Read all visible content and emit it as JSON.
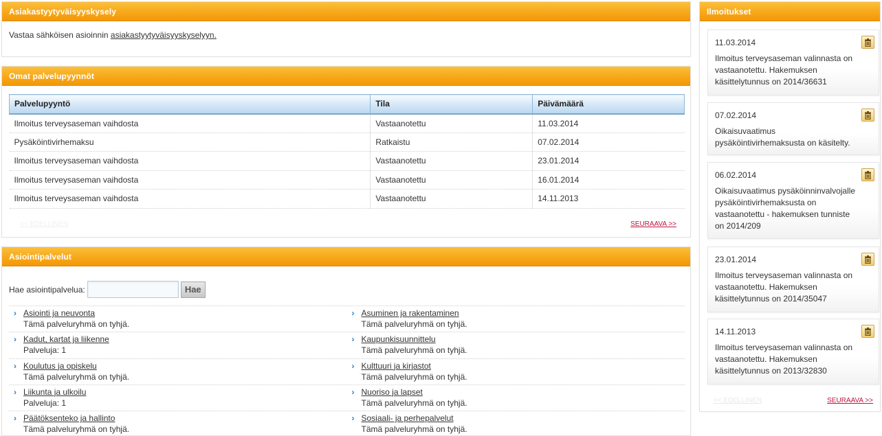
{
  "survey": {
    "title": "Asiakastyytyväisyyskysely",
    "text_prefix": "Vastaa sähköisen asioinnin",
    "link": "asiakastyytyväisyyskyselyyn."
  },
  "requests": {
    "title": "Omat palvelupyynnöt",
    "columns": [
      "Palvelupyyntö",
      "Tila",
      "Päivämäärä"
    ],
    "rows": [
      [
        "Ilmoitus terveysaseman vaihdosta",
        "Vastaanotettu",
        "11.03.2014"
      ],
      [
        "Pysäköintivirhemaksu",
        "Ratkaistu",
        "07.02.2014"
      ],
      [
        "Ilmoitus terveysaseman vaihdosta",
        "Vastaanotettu",
        "23.01.2014"
      ],
      [
        "Ilmoitus terveysaseman vaihdosta",
        "Vastaanotettu",
        "16.01.2014"
      ],
      [
        "Ilmoitus terveysaseman vaihdosta",
        "Vastaanotettu",
        "14.11.2013"
      ]
    ],
    "prev": "<< EDELLINEN",
    "next": "SEURAAVA >>"
  },
  "services": {
    "title": "Asiointipalvelut",
    "search_label": "Hae asiointipalvelua:",
    "search_value": "",
    "search_button": "Hae",
    "chevron": "›",
    "items": [
      {
        "name": "Asiointi ja neuvonta",
        "sub": "Tämä palveluryhmä on tyhjä."
      },
      {
        "name": "Asuminen ja rakentaminen",
        "sub": "Tämä palveluryhmä on tyhjä."
      },
      {
        "name": "Kadut, kartat ja liikenne",
        "sub": "Palveluja: 1"
      },
      {
        "name": "Kaupunkisuunnittelu",
        "sub": "Tämä palveluryhmä on tyhjä."
      },
      {
        "name": "Koulutus ja opiskelu",
        "sub": "Tämä palveluryhmä on tyhjä."
      },
      {
        "name": "Kulttuuri ja kirjastot",
        "sub": "Tämä palveluryhmä on tyhjä."
      },
      {
        "name": "Liikunta ja ulkoilu",
        "sub": "Palveluja: 1"
      },
      {
        "name": "Nuoriso ja lapset",
        "sub": "Tämä palveluryhmä on tyhjä."
      },
      {
        "name": "Päätöksenteko ja hallinto",
        "sub": "Tämä palveluryhmä on tyhjä."
      },
      {
        "name": "Sosiaali- ja perhepalvelut",
        "sub": "Tämä palveluryhmä on tyhjä."
      }
    ]
  },
  "notices": {
    "title": "Ilmoitukset",
    "items": [
      {
        "date": "11.03.2014",
        "text": "Ilmoitus terveysaseman valinnasta on vastaanotettu. Hakemuksen käsittelytunnus on 2014/36631"
      },
      {
        "date": "07.02.2014",
        "text": "Oikaisuvaatimus pysäköintivirhemaksusta on käsitelty."
      },
      {
        "date": "06.02.2014",
        "text": "Oikaisuvaatimus pysäköinninvalvojalle pysäköintivirhemaksusta on vastaanotettu - hakemuksen tunniste on 2014/209"
      },
      {
        "date": "23.01.2014",
        "text": "Ilmoitus terveysaseman valinnasta on vastaanotettu. Hakemuksen käsittelytunnus on 2014/35047"
      },
      {
        "date": "14.11.2013",
        "text": "Ilmoitus terveysaseman valinnasta on vastaanotettu. Hakemuksen käsittelytunnus on 2013/32830"
      }
    ],
    "delete_icon": "trash-icon",
    "prev": "<< EDELLINEN",
    "next": "SEURAAVA >>"
  },
  "colors": {
    "header_orange": "#f7a81a",
    "table_header_blue": "#bcd7ee",
    "link_red": "#c0143c",
    "chevron_blue": "#2a7fc4"
  }
}
